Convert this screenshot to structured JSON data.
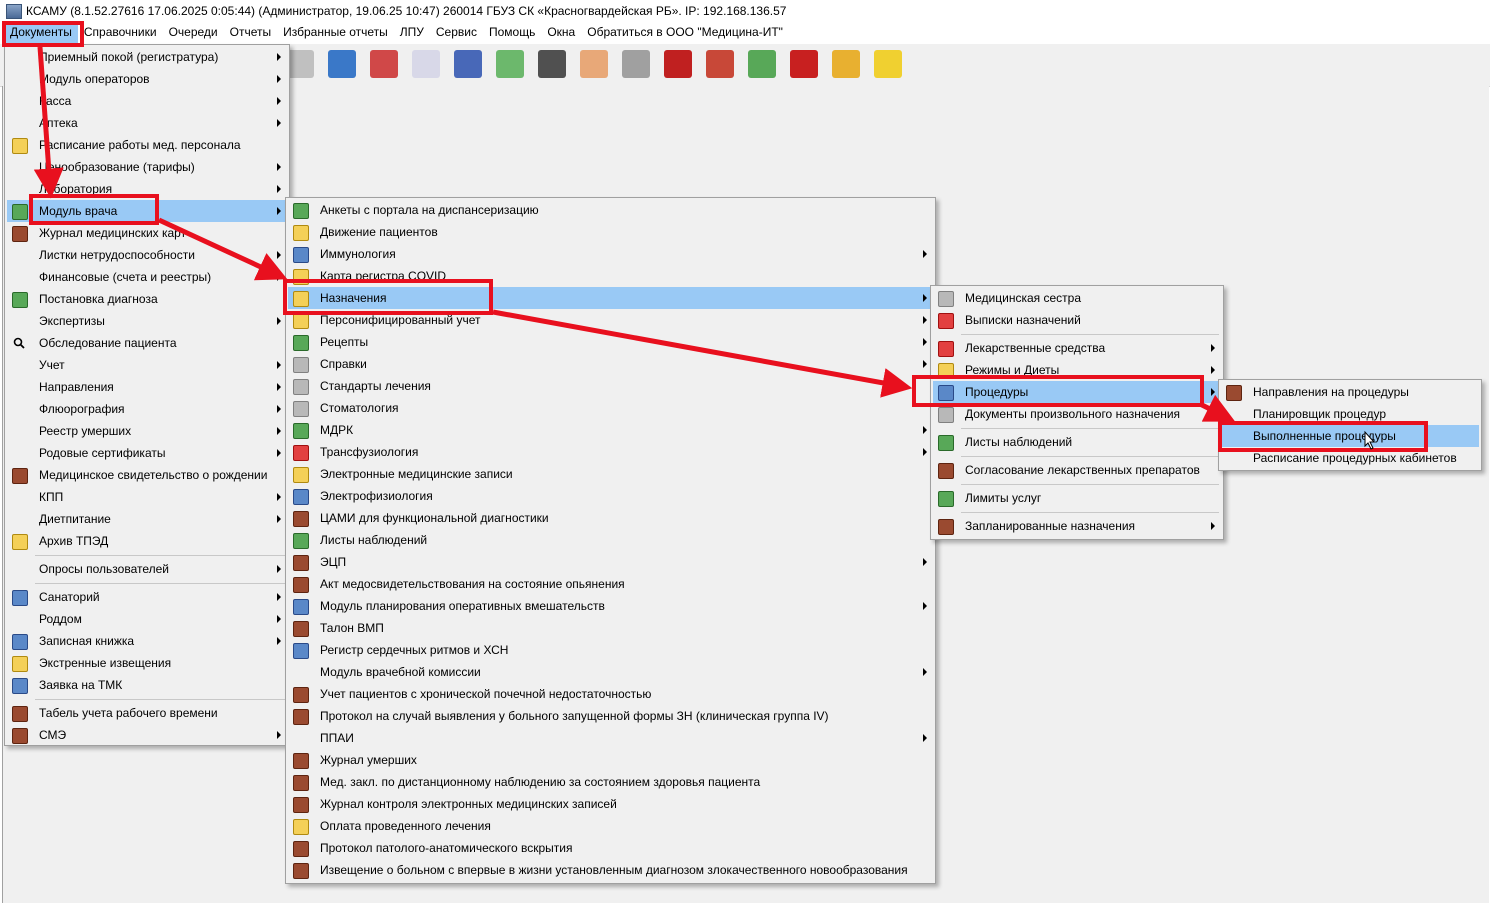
{
  "window": {
    "title": "КСАМУ (8.1.52.27616 17.06.2025 0:05:44) (Администратор, 19.06.25 10:47)  260014 ГБУЗ СК «Красногвардейская РБ». IP: 192.168.136.57"
  },
  "menubar": [
    "Документы",
    "Справочники",
    "Очереди",
    "Отчеты",
    "Избранные отчеты",
    "ЛПУ",
    "Сервис",
    "Помощь",
    "Окна",
    "Обратиться в ООО \"Медицина-ИТ\""
  ],
  "menu1": [
    {
      "label": "Приемный покой (регистратура)",
      "icon": "",
      "sub": true
    },
    {
      "label": "Модуль операторов",
      "icon": "",
      "sub": true
    },
    {
      "label": "Касса",
      "icon": "",
      "sub": true
    },
    {
      "label": "Аптека",
      "icon": "",
      "sub": true
    },
    {
      "label": "Расписание работы мед. персонала",
      "icon": "note",
      "sub": false
    },
    {
      "label": "Ценообразование (тарифы)",
      "icon": "",
      "sub": true
    },
    {
      "label": "Лаборатория",
      "icon": "",
      "sub": true
    },
    {
      "label": "Модуль врача",
      "icon": "green",
      "sub": true,
      "hl": true
    },
    {
      "label": "Журнал медицинских карт",
      "icon": "book",
      "sub": false
    },
    {
      "label": "Листки нетрудоспособности",
      "icon": "",
      "sub": true
    },
    {
      "label": "Финансовые (счета и реестры)",
      "icon": "",
      "sub": true
    },
    {
      "label": "Постановка диагноза",
      "icon": "green",
      "sub": false
    },
    {
      "label": "Экспертизы",
      "icon": "",
      "sub": true
    },
    {
      "label": "Обследование пациента",
      "icon": "magn",
      "sub": false
    },
    {
      "label": "Учет",
      "icon": "",
      "sub": true
    },
    {
      "label": "Направления",
      "icon": "",
      "sub": true
    },
    {
      "label": "Флюорография",
      "icon": "",
      "sub": true
    },
    {
      "label": "Реестр умерших",
      "icon": "",
      "sub": true
    },
    {
      "label": "Родовые сертификаты",
      "icon": "",
      "sub": true
    },
    {
      "label": "Медицинское свидетельство о рождении",
      "icon": "book",
      "sub": false
    },
    {
      "label": "КПП",
      "icon": "",
      "sub": true
    },
    {
      "label": "Диетпитание",
      "icon": "",
      "sub": true
    },
    {
      "label": "Архив ТПЭД",
      "icon": "note",
      "sub": false
    },
    {
      "sep": true
    },
    {
      "label": "Опросы пользователей",
      "icon": "",
      "sub": true
    },
    {
      "sep": true
    },
    {
      "label": "Санаторий",
      "icon": "blue",
      "sub": true
    },
    {
      "label": "Роддом",
      "icon": "",
      "sub": true
    },
    {
      "label": "Записная книжка",
      "icon": "blue",
      "sub": true
    },
    {
      "label": "Экстренные извещения",
      "icon": "note",
      "sub": false
    },
    {
      "label": "Заявка на ТМК",
      "icon": "blue",
      "sub": false
    },
    {
      "sep": true
    },
    {
      "label": "Табель учета рабочего времени",
      "icon": "book",
      "sub": false
    },
    {
      "label": "СМЭ",
      "icon": "book",
      "sub": true
    }
  ],
  "menu2": [
    {
      "label": "Анкеты с портала на диспансеризацию",
      "icon": "green",
      "sub": false
    },
    {
      "label": "Движение пациентов",
      "icon": "note",
      "sub": false
    },
    {
      "label": "Иммунология",
      "icon": "blue",
      "sub": true
    },
    {
      "label": "Карта регистра COVID",
      "icon": "note",
      "sub": false
    },
    {
      "label": "Назначения",
      "icon": "note",
      "sub": true,
      "hl": true
    },
    {
      "label": "Персонифицированный учет",
      "icon": "note",
      "sub": true
    },
    {
      "label": "Рецепты",
      "icon": "green",
      "sub": true
    },
    {
      "label": "Справки",
      "icon": "gray",
      "sub": true
    },
    {
      "label": "Стандарты лечения",
      "icon": "gray",
      "sub": false
    },
    {
      "label": "Стоматология",
      "icon": "gray",
      "sub": false
    },
    {
      "label": "МДРК",
      "icon": "green",
      "sub": true
    },
    {
      "label": "Трансфузиология",
      "icon": "red",
      "sub": true
    },
    {
      "label": "Электронные медицинские записи",
      "icon": "note",
      "sub": false
    },
    {
      "label": "Электрофизиология",
      "icon": "blue",
      "sub": false
    },
    {
      "label": "ЦАМИ для функциональной диагностики",
      "icon": "book",
      "sub": false
    },
    {
      "label": "Листы наблюдений",
      "icon": "green",
      "sub": false
    },
    {
      "label": "ЭЦП",
      "icon": "book",
      "sub": true
    },
    {
      "label": "Акт медосвидетельствования на состояние опьянения",
      "icon": "book",
      "sub": false
    },
    {
      "label": "Модуль планирования оперативных вмешательств",
      "icon": "blue",
      "sub": true
    },
    {
      "label": "Талон ВМП",
      "icon": "book",
      "sub": false
    },
    {
      "label": "Регистр сердечных ритмов и ХСН",
      "icon": "blue",
      "sub": false
    },
    {
      "label": "Модуль врачебной комиссии",
      "icon": "",
      "sub": true
    },
    {
      "label": "Учет пациентов с хронической почечной недостаточностью",
      "icon": "book",
      "sub": false
    },
    {
      "label": "Протокол на случай выявления у больного запущенной формы ЗН (клиническая группа IV)",
      "icon": "book",
      "sub": false
    },
    {
      "label": "ППАИ",
      "icon": "",
      "sub": true
    },
    {
      "label": "Журнал умерших",
      "icon": "book",
      "sub": false
    },
    {
      "label": "Мед. закл. по дистанционному наблюдению за состоянием здоровья пациента",
      "icon": "book",
      "sub": false
    },
    {
      "label": "Журнал контроля электронных медицинских записей",
      "icon": "book",
      "sub": false
    },
    {
      "label": "Оплата проведенного лечения",
      "icon": "note",
      "sub": false
    },
    {
      "label": "Протокол патолого-анатомического вскрытия",
      "icon": "book",
      "sub": false
    },
    {
      "label": "Извещение о больном с впервые в жизни установленным диагнозом злокачественного новообразования",
      "icon": "book",
      "sub": false
    }
  ],
  "menu3": [
    {
      "label": "Медицинская сестра",
      "icon": "gray",
      "sub": false
    },
    {
      "label": "Выписки назначений",
      "icon": "red",
      "sub": false
    },
    {
      "sep": true
    },
    {
      "label": "Лекарственные средства",
      "icon": "red",
      "sub": true
    },
    {
      "label": "Режимы и Диеты",
      "icon": "note",
      "sub": true
    },
    {
      "label": "Процедуры",
      "icon": "blue",
      "sub": true,
      "hl": true
    },
    {
      "label": "Документы произвольного назначения",
      "icon": "gray",
      "sub": false
    },
    {
      "sep": true
    },
    {
      "label": "Листы наблюдений",
      "icon": "green",
      "sub": false
    },
    {
      "sep": true
    },
    {
      "label": "Согласование лекарственных препаратов",
      "icon": "book",
      "sub": false
    },
    {
      "sep": true
    },
    {
      "label": "Лимиты услуг",
      "icon": "green",
      "sub": false
    },
    {
      "sep": true
    },
    {
      "label": "Запланированные назначения",
      "icon": "book",
      "sub": true
    }
  ],
  "menu4": [
    {
      "label": "Направления на процедуры",
      "icon": "book",
      "sub": false
    },
    {
      "label": "Планировщик процедур",
      "icon": "",
      "sub": false
    },
    {
      "label": "Выполненные процедуры",
      "icon": "",
      "sub": false,
      "hl": true
    },
    {
      "label": "Расписание процедурных кабинетов",
      "icon": "",
      "sub": false
    }
  ],
  "toolbar_icons": [
    "scissors-icon",
    "calendar-icon",
    "medkit-icon",
    "document-icon",
    "books-icon",
    "pills-icon",
    "scanner-icon",
    "nurse-icon",
    "thermometer-icon",
    "red-book-icon",
    "schedule-icon",
    "ledger-icon",
    "pdf-icon",
    "lock-icon",
    "message-icon"
  ]
}
